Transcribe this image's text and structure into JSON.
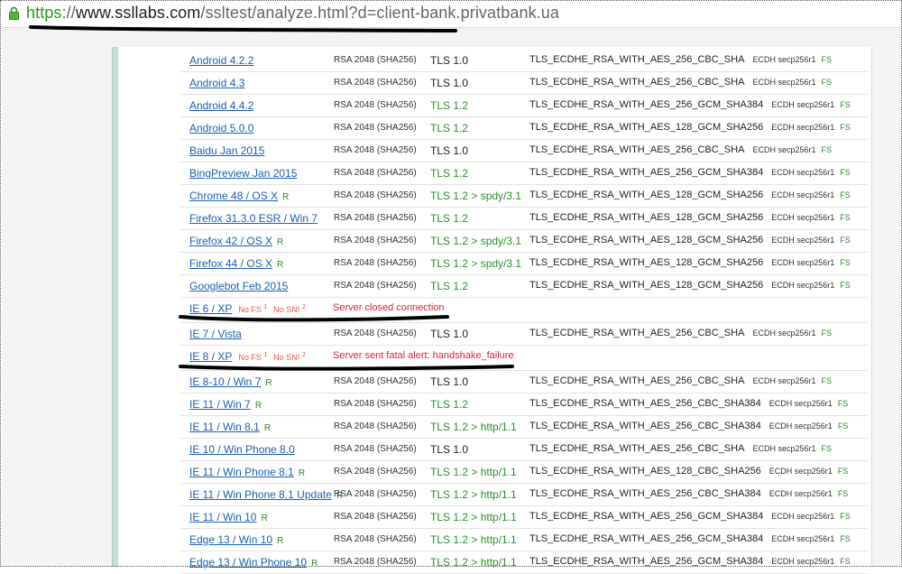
{
  "address_bar": {
    "scheme": "https",
    "separator": "://",
    "domain": "www.ssllabs.com",
    "path": "/ssltest/analyze.html?d=client-bank.privatbank.ua"
  },
  "rows": [
    {
      "client": "Android 4.2.2",
      "r": "",
      "cert": "RSA 2048 (SHA256)",
      "protocol": "TLS 1.0",
      "protocol_green": false,
      "suite": "TLS_ECDHE_RSA_WITH_AES_256_CBC_SHA",
      "kx": "ECDH secp256r1",
      "fs": "FS"
    },
    {
      "client": "Android 4.3",
      "r": "",
      "cert": "RSA 2048 (SHA256)",
      "protocol": "TLS 1.0",
      "protocol_green": false,
      "suite": "TLS_ECDHE_RSA_WITH_AES_256_CBC_SHA",
      "kx": "ECDH secp256r1",
      "fs": "FS"
    },
    {
      "client": "Android 4.4.2",
      "r": "",
      "cert": "RSA 2048 (SHA256)",
      "protocol": "TLS 1.2",
      "protocol_green": true,
      "suite": "TLS_ECDHE_RSA_WITH_AES_256_GCM_SHA384",
      "kx": "ECDH secp256r1",
      "fs": "FS"
    },
    {
      "client": "Android 5.0.0",
      "r": "",
      "cert": "RSA 2048 (SHA256)",
      "protocol": "TLS 1.2",
      "protocol_green": true,
      "suite": "TLS_ECDHE_RSA_WITH_AES_128_GCM_SHA256",
      "kx": "ECDH secp256r1",
      "fs": "FS"
    },
    {
      "client": "Baidu Jan 2015",
      "r": "",
      "cert": "RSA 2048 (SHA256)",
      "protocol": "TLS 1.0",
      "protocol_green": false,
      "suite": "TLS_ECDHE_RSA_WITH_AES_256_CBC_SHA",
      "kx": "ECDH secp256r1",
      "fs": "FS"
    },
    {
      "client": "BingPreview Jan 2015",
      "r": "",
      "cert": "RSA 2048 (SHA256)",
      "protocol": "TLS 1.2",
      "protocol_green": true,
      "suite": "TLS_ECDHE_RSA_WITH_AES_256_GCM_SHA384",
      "kx": "ECDH secp256r1",
      "fs": "FS"
    },
    {
      "client": "Chrome 48 / OS X",
      "r": "R",
      "cert": "RSA 2048 (SHA256)",
      "protocol": "TLS 1.2 > spdy/3.1",
      "protocol_green": true,
      "suite": "TLS_ECDHE_RSA_WITH_AES_128_GCM_SHA256",
      "kx": "ECDH secp256r1",
      "fs": "FS"
    },
    {
      "client": "Firefox 31.3.0 ESR / Win 7",
      "r": "",
      "cert": "RSA 2048 (SHA256)",
      "protocol": "TLS 1.2",
      "protocol_green": true,
      "suite": "TLS_ECDHE_RSA_WITH_AES_128_GCM_SHA256",
      "kx": "ECDH secp256r1",
      "fs": "FS"
    },
    {
      "client": "Firefox 42 / OS X",
      "r": "R",
      "cert": "RSA 2048 (SHA256)",
      "protocol": "TLS 1.2 > spdy/3.1",
      "protocol_green": true,
      "suite": "TLS_ECDHE_RSA_WITH_AES_128_GCM_SHA256",
      "kx": "ECDH secp256r1",
      "fs": "FS"
    },
    {
      "client": "Firefox 44 / OS X",
      "r": "R",
      "cert": "RSA 2048 (SHA256)",
      "protocol": "TLS 1.2 > spdy/3.1",
      "protocol_green": true,
      "suite": "TLS_ECDHE_RSA_WITH_AES_128_GCM_SHA256",
      "kx": "ECDH secp256r1",
      "fs": "FS"
    },
    {
      "client": "Googlebot Feb 2015",
      "r": "",
      "cert": "RSA 2048 (SHA256)",
      "protocol": "TLS 1.2",
      "protocol_green": true,
      "suite": "TLS_ECDHE_RSA_WITH_AES_128_GCM_SHA256",
      "kx": "ECDH secp256r1",
      "fs": "FS"
    },
    {
      "client": "IE 6 / XP",
      "failed": true,
      "nofs": "No FS",
      "nofs_sup": "1",
      "nosni": "No SNI",
      "nosni_sup": "2",
      "error": "Server closed connection"
    },
    {
      "client": "IE 7 / Vista",
      "r": "",
      "cert": "RSA 2048 (SHA256)",
      "protocol": "TLS 1.0",
      "protocol_green": false,
      "suite": "TLS_ECDHE_RSA_WITH_AES_256_CBC_SHA",
      "kx": "ECDH secp256r1",
      "fs": "FS"
    },
    {
      "client": "IE 8 / XP",
      "failed": true,
      "nofs": "No FS",
      "nofs_sup": "1",
      "nosni": "No SNI",
      "nosni_sup": "2",
      "error": "Server sent fatal alert: handshake_failure"
    },
    {
      "client": "IE 8-10 / Win 7",
      "r": "R",
      "cert": "RSA 2048 (SHA256)",
      "protocol": "TLS 1.0",
      "protocol_green": false,
      "suite": "TLS_ECDHE_RSA_WITH_AES_256_CBC_SHA",
      "kx": "ECDH secp256r1",
      "fs": "FS"
    },
    {
      "client": "IE 11 / Win 7",
      "r": "R",
      "cert": "RSA 2048 (SHA256)",
      "protocol": "TLS 1.2",
      "protocol_green": true,
      "suite": "TLS_ECDHE_RSA_WITH_AES_256_CBC_SHA384",
      "kx": "ECDH secp256r1",
      "fs": "FS"
    },
    {
      "client": "IE 11 / Win 8.1",
      "r": "R",
      "cert": "RSA 2048 (SHA256)",
      "protocol": "TLS 1.2 > http/1.1",
      "protocol_green": true,
      "suite": "TLS_ECDHE_RSA_WITH_AES_256_CBC_SHA384",
      "kx": "ECDH secp256r1",
      "fs": "FS"
    },
    {
      "client": "IE 10 / Win Phone 8.0",
      "r": "",
      "cert": "RSA 2048 (SHA256)",
      "protocol": "TLS 1.0",
      "protocol_green": false,
      "suite": "TLS_ECDHE_RSA_WITH_AES_256_CBC_SHA",
      "kx": "ECDH secp256r1",
      "fs": "FS"
    },
    {
      "client": "IE 11 / Win Phone 8.1",
      "r": "R",
      "cert": "RSA 2048 (SHA256)",
      "protocol": "TLS 1.2 > http/1.1",
      "protocol_green": true,
      "suite": "TLS_ECDHE_RSA_WITH_AES_128_CBC_SHA256",
      "kx": "ECDH secp256r1",
      "fs": "FS"
    },
    {
      "client": "IE 11 / Win Phone 8.1 Update",
      "r": "R",
      "cert": "RSA 2048 (SHA256)",
      "protocol": "TLS 1.2 > http/1.1",
      "protocol_green": true,
      "suite": "TLS_ECDHE_RSA_WITH_AES_256_CBC_SHA384",
      "kx": "ECDH secp256r1",
      "fs": "FS"
    },
    {
      "client": "IE 11 / Win 10",
      "r": "R",
      "cert": "RSA 2048 (SHA256)",
      "protocol": "TLS 1.2 > http/1.1",
      "protocol_green": true,
      "suite": "TLS_ECDHE_RSA_WITH_AES_256_GCM_SHA384",
      "kx": "ECDH secp256r1",
      "fs": "FS"
    },
    {
      "client": "Edge 13 / Win 10",
      "r": "R",
      "cert": "RSA 2048 (SHA256)",
      "protocol": "TLS 1.2 > http/1.1",
      "protocol_green": true,
      "suite": "TLS_ECDHE_RSA_WITH_AES_256_GCM_SHA384",
      "kx": "ECDH secp256r1",
      "fs": "FS"
    },
    {
      "client": "Edge 13 / Win Phone 10",
      "r": "R",
      "cert": "RSA 2048 (SHA256)",
      "protocol": "TLS 1.2 > http/1.1",
      "protocol_green": true,
      "suite": "TLS_ECDHE_RSA_WITH_AES_256_GCM_SHA384",
      "kx": "ECDH secp256r1",
      "fs": "FS"
    }
  ]
}
